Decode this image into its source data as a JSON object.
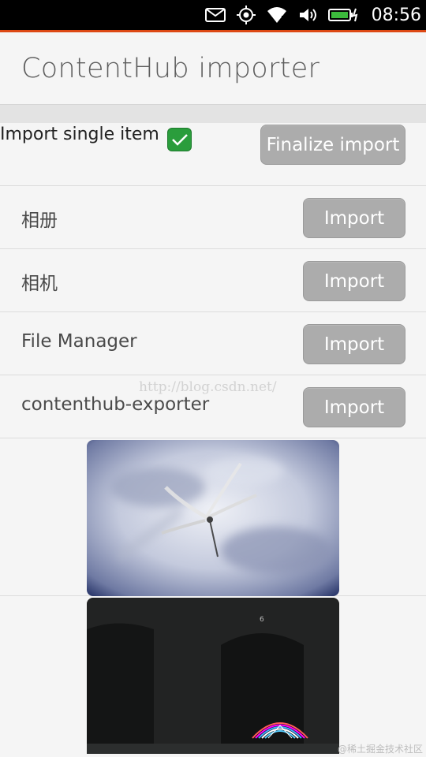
{
  "status_bar": {
    "time": "08:56",
    "icons": [
      "mail-icon",
      "location-icon",
      "wifi-icon",
      "volume-icon",
      "battery-charging-icon"
    ]
  },
  "header": {
    "title": "ContentHub importer"
  },
  "import_options": {
    "single_item_label": "Import single item",
    "single_item_checked": true,
    "finalize_label": "Finalize import"
  },
  "apps": [
    {
      "name": "相册",
      "button": "Import"
    },
    {
      "name": "相机",
      "button": "Import"
    },
    {
      "name": "File Manager",
      "button": "Import"
    },
    {
      "name": "contenthub-exporter",
      "button": "Import"
    }
  ],
  "watermark": "http://blog.csdn.net/",
  "imported_images": [
    {
      "subject": "dragonfly-on-sky"
    },
    {
      "subject": "dark-building-light-painting"
    }
  ],
  "credit": "@稀土掘金技术社区",
  "colors": {
    "accent": "#dd4814",
    "checkbox": "#2a9d3c",
    "button": "#acacac",
    "background": "#f5f5f5"
  }
}
